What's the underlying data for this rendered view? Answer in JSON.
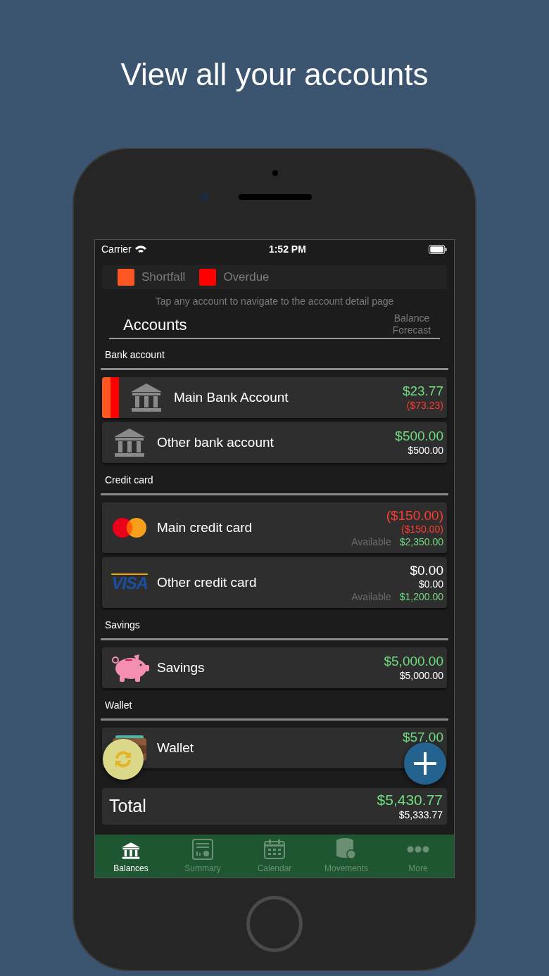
{
  "headline": "View all your accounts",
  "status_bar": {
    "carrier": "Carrier",
    "time": "1:52 PM"
  },
  "legend": [
    {
      "label": "Shortfall",
      "color": "#ff5722"
    },
    {
      "label": "Overdue",
      "color": "#ff0000"
    }
  ],
  "hint": "Tap any account to navigate to the account detail page",
  "header": {
    "title": "Accounts",
    "column_label": "Balance Forecast"
  },
  "sections": [
    {
      "title": "Bank account",
      "accounts": [
        {
          "name": "Main Bank Account",
          "kind": "bank",
          "shortfall": true,
          "overdue": true,
          "balance": {
            "text": "$23.77",
            "color": "#6fdc7f"
          },
          "forecast": {
            "text": "($73.23)",
            "color": "#ff3b30"
          }
        },
        {
          "name": "Other bank account",
          "kind": "bank",
          "shortfall": false,
          "overdue": false,
          "balance": {
            "text": "$500.00",
            "color": "#6fdc7f"
          },
          "forecast": {
            "text": "$500.00",
            "color": "#ffffff"
          }
        }
      ]
    },
    {
      "title": "Credit card",
      "accounts": [
        {
          "name": "Main credit card",
          "kind": "mastercard",
          "shortfall": false,
          "overdue": false,
          "balance": {
            "text": "($150.00)",
            "color": "#ff3b30"
          },
          "forecast": {
            "text": "($150.00)",
            "color": "#ff3b30"
          },
          "available_label": "Available",
          "available": {
            "text": "$2,350.00",
            "color": "#6fdc7f"
          }
        },
        {
          "name": "Other credit card",
          "kind": "visa",
          "logo_text": "VISA",
          "shortfall": false,
          "overdue": false,
          "balance": {
            "text": "$0.00",
            "color": "#ffffff"
          },
          "forecast": {
            "text": "$0.00",
            "color": "#ffffff"
          },
          "available_label": "Available",
          "available": {
            "text": "$1,200.00",
            "color": "#6fdc7f"
          }
        }
      ]
    },
    {
      "title": "Savings",
      "accounts": [
        {
          "name": "Savings",
          "kind": "piggy",
          "shortfall": false,
          "overdue": false,
          "balance": {
            "text": "$5,000.00",
            "color": "#6fdc7f"
          },
          "forecast": {
            "text": "$5,000.00",
            "color": "#ffffff"
          }
        }
      ]
    },
    {
      "title": "Wallet",
      "accounts": [
        {
          "name": "Wallet",
          "kind": "wallet",
          "shortfall": false,
          "overdue": false,
          "balance": {
            "text": "$57.00",
            "color": "#6fdc7f"
          }
        }
      ]
    }
  ],
  "total": {
    "label": "Total",
    "balance": {
      "text": "$5,430.77",
      "color": "#6fdc7f"
    },
    "forecast": {
      "text": "$5,333.77",
      "color": "#ffffff"
    }
  },
  "tabs": [
    {
      "label": "Balances",
      "kind": "bank",
      "selected": true
    },
    {
      "label": "Summary",
      "kind": "report",
      "selected": false
    },
    {
      "label": "Calendar",
      "kind": "calendar",
      "selected": false
    },
    {
      "label": "Movements",
      "kind": "coins",
      "selected": false
    },
    {
      "label": "More",
      "kind": "more",
      "selected": false
    }
  ]
}
